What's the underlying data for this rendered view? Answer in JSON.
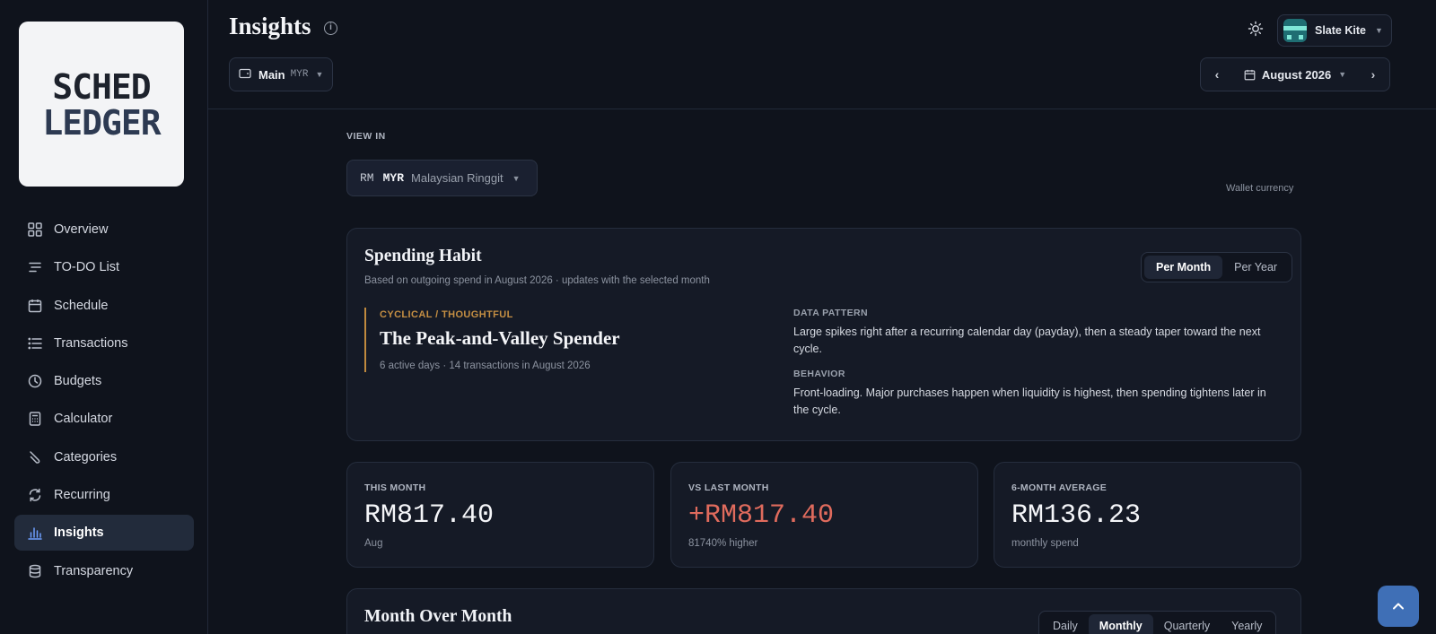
{
  "app": {
    "logo_text_line1": "SCHED",
    "logo_text_line2": "LEDGER"
  },
  "sidebar": {
    "items": [
      {
        "label": "Overview",
        "icon": "grid-icon"
      },
      {
        "label": "TO-DO List",
        "icon": "list-check-icon"
      },
      {
        "label": "Schedule",
        "icon": "calendar-icon"
      },
      {
        "label": "Transactions",
        "icon": "list-icon"
      },
      {
        "label": "Budgets",
        "icon": "clock-icon"
      },
      {
        "label": "Calculator",
        "icon": "calculator-icon"
      },
      {
        "label": "Categories",
        "icon": "tag-icon"
      },
      {
        "label": "Recurring",
        "icon": "refresh-icon"
      },
      {
        "label": "Insights",
        "icon": "bar-chart-icon",
        "active": true
      },
      {
        "label": "Transparency",
        "icon": "database-icon"
      }
    ]
  },
  "header": {
    "title": "Insights",
    "wallet": {
      "name": "Main",
      "currency": "MYR"
    },
    "user": {
      "name": "Slate Kite"
    },
    "month": "August 2026"
  },
  "view": {
    "label": "VIEW IN",
    "currency_symbol": "RM",
    "currency_code": "MYR",
    "currency_name": "Malaysian Ringgit",
    "hint": "Wallet currency"
  },
  "habit": {
    "title": "Spending Habit",
    "subtitle": "Based on outgoing spend in August 2026 · updates with the selected month",
    "periods": [
      "Per Month",
      "Per Year"
    ],
    "selected_period": "Per Month",
    "tag": "CYCLICAL / THOUGHTFUL",
    "persona": "The Peak-and-Valley Spender",
    "meta": "6 active days · 14 transactions in August 2026",
    "pattern_label": "DATA PATTERN",
    "pattern_text": "Large spikes right after a recurring calendar day (payday), then a steady taper toward the next cycle.",
    "behavior_label": "BEHAVIOR",
    "behavior_text": "Front-loading. Major purchases happen when liquidity is highest, then spending tightens later in the cycle."
  },
  "stats": [
    {
      "label": "THIS MONTH",
      "value": "RM817.40",
      "note": "Aug"
    },
    {
      "label": "VS LAST MONTH",
      "value": "+RM817.40",
      "note": "81740% higher"
    },
    {
      "label": "6-MONTH AVERAGE",
      "value": "RM136.23",
      "note": "monthly spend"
    }
  ],
  "mom": {
    "title": "Month Over Month",
    "ranges": [
      "Daily",
      "Monthly",
      "Quarterly",
      "Yearly"
    ],
    "selected_range": "Monthly"
  },
  "colors": {
    "accent": "#3f6fb6",
    "warning_gold": "#c58f43",
    "negative": "#e06b5d",
    "background": "#0f131c"
  }
}
